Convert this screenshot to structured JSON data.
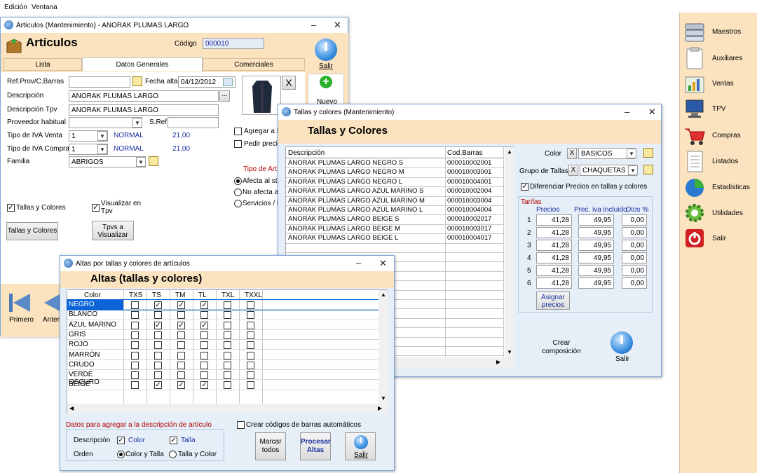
{
  "menubar": {
    "edit": "Edición",
    "window": "Ventana"
  },
  "sidebar": {
    "items": [
      {
        "label": "Maestros"
      },
      {
        "label": "Auxiliares"
      },
      {
        "label": "Ventas"
      },
      {
        "label": "TPV"
      },
      {
        "label": "Compras"
      },
      {
        "label": "Listados"
      },
      {
        "label": "Estadísticas"
      },
      {
        "label": "Utilidades"
      },
      {
        "label": "Salir"
      }
    ]
  },
  "articulos": {
    "title": "Artículos (Mantenimiento) - ANORAK PLUMAS LARGO",
    "heading": "Artículos",
    "codigo_label": "Código",
    "codigo_value": "000010",
    "salir": "Salir",
    "nuevo": "Nuevo",
    "tabs": [
      "Lista",
      "Datos Generales",
      "Comerciales"
    ],
    "ref_label": "Ref.Prov/C.Barras",
    "fecha_label": "Fecha alta",
    "fecha_value": "04/12/2012",
    "descripcion_label": "Descripción",
    "descripcion_value": "ANORAK PLUMAS LARGO",
    "descripcion_tpv_label": "Descripción Tpv",
    "descripcion_tpv_value": "ANORAK PLUMAS LARGO",
    "proveedor_label": "Proveedor habitual",
    "sref_label": "S.Ref",
    "iva_venta_label": "Tipo de IVA Venta",
    "iva_venta_value": "1",
    "iva_venta_name": "NORMAL",
    "iva_venta_rate": "21,00",
    "iva_compra_label": "Tipo de IVA Compra",
    "iva_compra_value": "1",
    "iva_compra_name": "NORMAL",
    "iva_compra_rate": "21,00",
    "familia_label": "Familia",
    "familia_value": "ABRIGOS",
    "agregar_fa": "Agregar a Fa",
    "pedir_precio": "Pedir precio",
    "tipo_art": "Tipo de Artíc",
    "afecta": "Afecta al stoc",
    "no_afecta": "No afecta al",
    "servicios": "Servicios / M",
    "tallas_colores_check": "Tallas y Colores",
    "visualizar_tpv": "Visualizar en Tpv",
    "tallas_colores_btn": "Tallas y Colores",
    "tpvs_btn": "Tpvs a Visualizar",
    "primero": "Primero",
    "anterior": "Anteric",
    "x": "X",
    "ellipsis": "..."
  },
  "tallas": {
    "title": "Tallas y colores (Mantenimiento)",
    "heading": "Tallas y Colores",
    "col_desc": "Descripción",
    "col_barras": "Cod.Barras",
    "rows": [
      {
        "desc": "ANORAK PLUMAS LARGO NEGRO S",
        "code": "000010002001"
      },
      {
        "desc": "ANORAK PLUMAS LARGO NEGRO M",
        "code": "000010003001"
      },
      {
        "desc": "ANORAK PLUMAS LARGO NEGRO L",
        "code": "000010004001"
      },
      {
        "desc": "ANORAK PLUMAS LARGO AZUL MARINO S",
        "code": "000010002004"
      },
      {
        "desc": "ANORAK PLUMAS LARGO AZUL MARINO M",
        "code": "000010003004"
      },
      {
        "desc": "ANORAK PLUMAS LARGO AZUL MARINO L",
        "code": "000010004004"
      },
      {
        "desc": "ANORAK PLUMAS LARGO BEIGE S",
        "code": "000010002017"
      },
      {
        "desc": "ANORAK PLUMAS LARGO BEIGE M",
        "code": "000010003017"
      },
      {
        "desc": "ANORAK PLUMAS LARGO BEIGE L",
        "code": "000010004017"
      }
    ],
    "color_label": "Color",
    "color_value": "BASICOS",
    "grupo_label": "Grupo de Tallas",
    "grupo_value": "CHAQUETAS Y",
    "diferenciar": "Diferenciar Precios en tallas y colores",
    "tarifas_label": "Tarifas",
    "precios_h": "Precios",
    "iva_h": "Prec. iva incluido",
    "dtos_h": "Dtos %",
    "tarifas": [
      {
        "n": "1",
        "precio": "41,28",
        "iva": "49,95",
        "dto": "0,00"
      },
      {
        "n": "2",
        "precio": "41,28",
        "iva": "49,95",
        "dto": "0,00"
      },
      {
        "n": "3",
        "precio": "41,28",
        "iva": "49,95",
        "dto": "0,00"
      },
      {
        "n": "4",
        "precio": "41,28",
        "iva": "49,95",
        "dto": "0,00"
      },
      {
        "n": "5",
        "precio": "41,28",
        "iva": "49,95",
        "dto": "0,00"
      },
      {
        "n": "6",
        "precio": "41,28",
        "iva": "49,95",
        "dto": "0,00"
      }
    ],
    "asignar": "Asignar precios",
    "crear": "Crear composición",
    "salir": "Salir",
    "x": "X"
  },
  "altas": {
    "title": "Altas por tallas y colores de artículos",
    "heading": "Altas (tallas y colores)",
    "cols": [
      "Color",
      "TXS",
      "TS",
      "TM",
      "TL",
      "TXL",
      "TXXL"
    ],
    "rows": [
      {
        "color": "NEGRO",
        "checks": [
          false,
          true,
          true,
          true,
          false,
          false
        ]
      },
      {
        "color": "BLANCO",
        "checks": [
          false,
          false,
          false,
          false,
          false,
          false
        ]
      },
      {
        "color": "AZUL MARINO",
        "checks": [
          false,
          true,
          true,
          true,
          false,
          false
        ]
      },
      {
        "color": "GRIS",
        "checks": [
          false,
          false,
          false,
          false,
          false,
          false
        ]
      },
      {
        "color": "ROJO",
        "checks": [
          false,
          false,
          false,
          false,
          false,
          false
        ]
      },
      {
        "color": "MARRÓN",
        "checks": [
          false,
          false,
          false,
          false,
          false,
          false
        ]
      },
      {
        "color": "CRUDO",
        "checks": [
          false,
          false,
          false,
          false,
          false,
          false
        ]
      },
      {
        "color": "VERDE OSCURO",
        "checks": [
          false,
          false,
          false,
          false,
          false,
          false
        ]
      },
      {
        "color": "BEIGE",
        "checks": [
          false,
          true,
          true,
          true,
          false,
          false
        ]
      }
    ],
    "datos_label": "Datos para agregar a  la descripción de artículo",
    "crear_codigos": "Crear códigos de barras automáticos",
    "descripcion_label": "Descripción",
    "color_opt": "Color",
    "talla_opt": "Talla",
    "orden_label": "Orden",
    "orden_1": "Color y Talla",
    "orden_2": "Talla y Color",
    "marcar": "Marcar todos",
    "procesar": "Procesar Altas",
    "salir": "Salir"
  }
}
